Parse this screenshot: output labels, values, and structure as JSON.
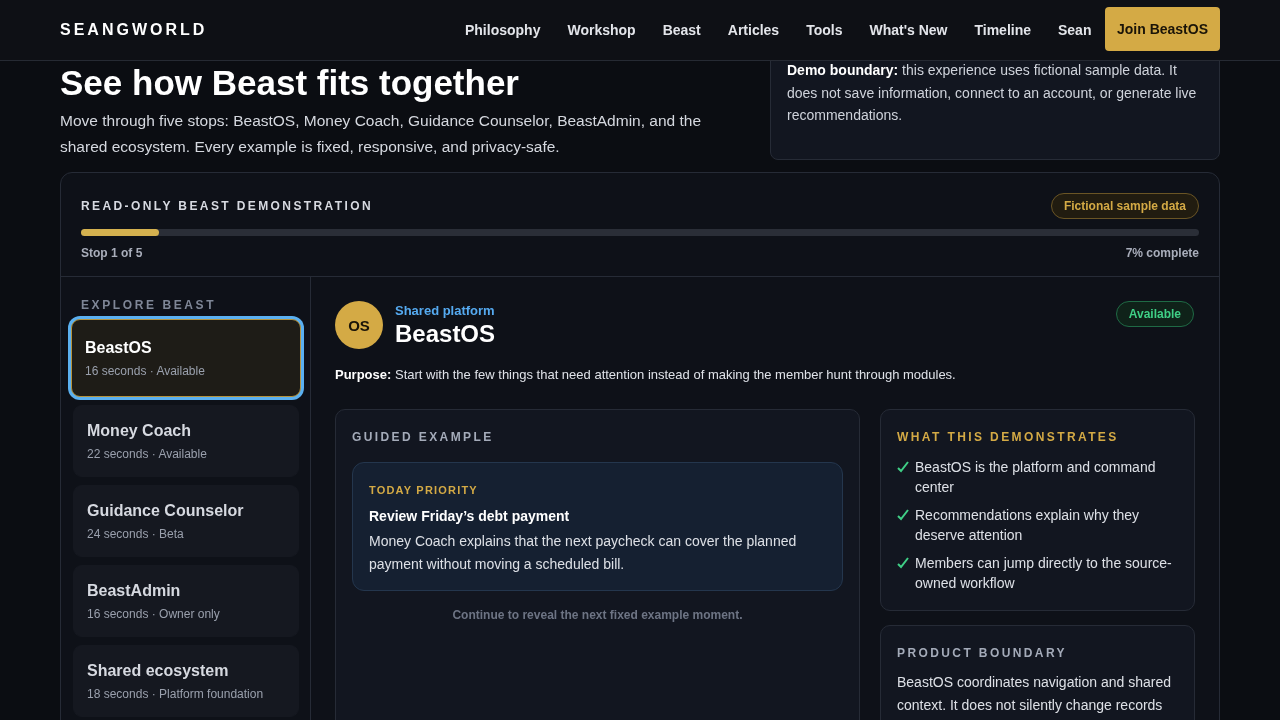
{
  "header": {
    "brand": "SEANGWORLD",
    "nav": [
      "Philosophy",
      "Workshop",
      "Beast",
      "Articles",
      "Tools",
      "What's New",
      "Timeline",
      "Sean"
    ],
    "cta": "Join BeastOS"
  },
  "intro": {
    "heading": "See how Beast fits together",
    "lead": "Move through five stops: BeastOS, Money Coach, Guidance Counselor, BeastAdmin, and the shared ecosystem. Every example is fixed, responsive, and privacy-safe.",
    "notice": "**Demo boundary:** this experience uses fictional sample data. It does not save information, connect to an account, or generate live recommendations."
  },
  "demo": {
    "title": "READ-ONLY BEAST DEMONSTRATION",
    "badge": "Fictional sample data",
    "progress": {
      "level": 0.07,
      "stop": "Stop 1 of 5",
      "reading": "7% complete"
    },
    "sidebar": {
      "heading": "EXPLORE BEAST",
      "items": [
        {
          "title": "BeastOS",
          "meta": "16 seconds · Available",
          "selected": true
        },
        {
          "title": "Money Coach",
          "meta": "22 seconds · Available",
          "selected": false
        },
        {
          "title": "Guidance Counselor",
          "meta": "24 seconds · Beta",
          "selected": false
        },
        {
          "title": "BeastAdmin",
          "meta": "16 seconds · Owner only",
          "selected": false
        },
        {
          "title": "Shared ecosystem",
          "meta": "18 seconds · Platform foundation",
          "selected": false
        }
      ]
    },
    "stop": {
      "avatar": "OS",
      "eyebrow": "Shared platform",
      "title": "BeastOS",
      "status": "Available",
      "purpose": "**Purpose:** Start with the few things that need attention instead of making the member hunt through modules.",
      "guided": {
        "heading": "GUIDED EXAMPLE",
        "card": {
          "eyebrow": "TODAY PRIORITY",
          "title": "Review Friday’s debt payment",
          "body": "Money Coach explains that the next paycheck can cover the planned payment without moving a scheduled bill."
        },
        "hint": "Continue to reveal the next fixed example moment."
      },
      "demonstrates": {
        "heading": "WHAT THIS DEMONSTRATES",
        "items": [
          "BeastOS is the platform and command center",
          "Recommendations explain why they deserve attention",
          "Members can jump directly to the source-owned workflow"
        ]
      },
      "boundary": {
        "heading": "PRODUCT BOUNDARY",
        "body": "BeastOS coordinates navigation and shared context. It does not silently change records"
      }
    }
  }
}
